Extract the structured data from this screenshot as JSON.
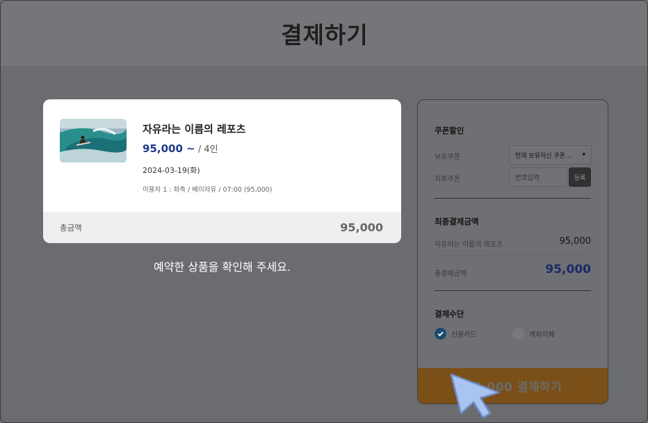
{
  "header": {
    "title": "결제하기"
  },
  "product": {
    "name": "자유라는 이름의 레포츠",
    "price": "95,000 ~",
    "people": " / 4인",
    "date": "2024-03-19(화)",
    "detail": "이용자 1 : 좌측 / 베이자유 / 07:00 (95,000)",
    "thumbnail_icon": "surfing-photo"
  },
  "total": {
    "label": "총금액",
    "value": "95,000"
  },
  "notice": "예약한 상품을 확인해 주세요.",
  "coupon": {
    "title": "쿠폰할인",
    "owned_label": "보유쿠폰",
    "owned_select": "현재 보유하신 쿠폰이 없습니다",
    "paper_label": "지류쿠폰",
    "code_placeholder": "번호입력",
    "register_label": "등록"
  },
  "final": {
    "title": "최종결제금액",
    "item_name": "자유라는 이름의 레포츠",
    "item_price": "95,000",
    "total_label": "총결제금액",
    "total_value": "95,000"
  },
  "payment": {
    "title": "결제수단",
    "options": [
      {
        "label": "신용카드",
        "selected": true
      },
      {
        "label": "계좌이체",
        "selected": false
      }
    ]
  },
  "pay_button": {
    "label": "95,000 결제하기"
  },
  "colors": {
    "accent": "#1d3a8a",
    "pay_button": "#7a5018",
    "overlay": "#6e6f72"
  }
}
